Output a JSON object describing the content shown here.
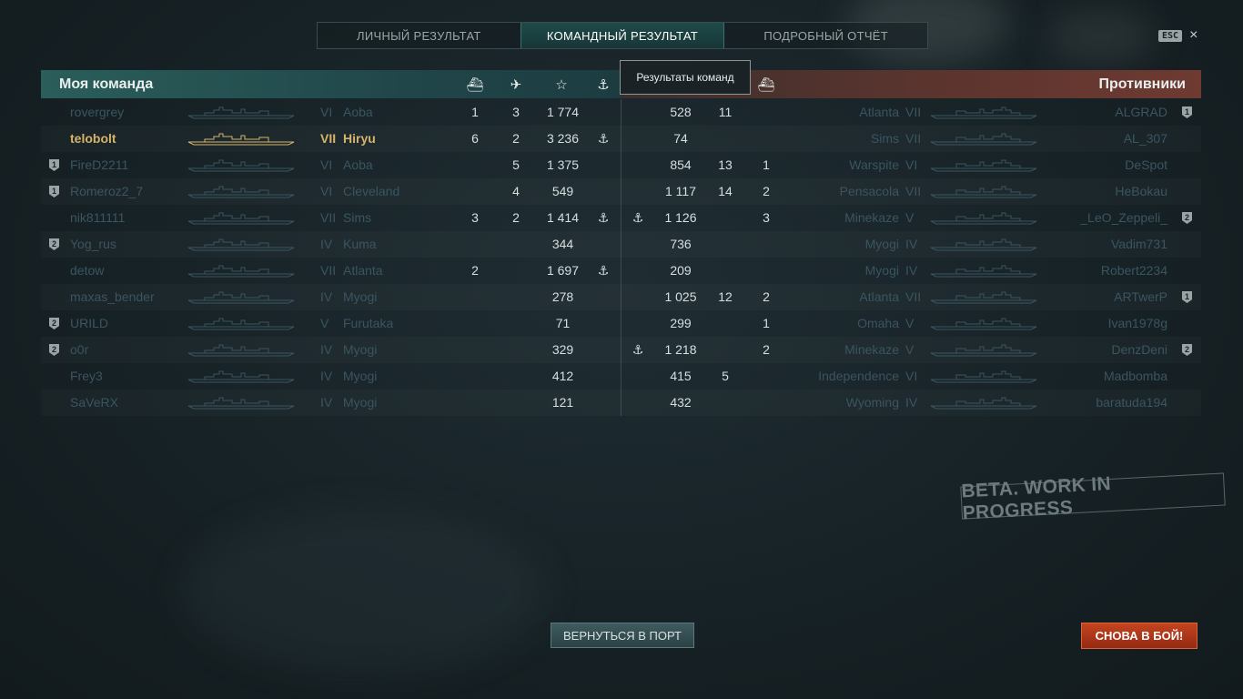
{
  "tabs": [
    {
      "label": "ЛИЧНЫЙ РЕЗУЛЬТАТ",
      "active": false
    },
    {
      "label": "КОМАНДНЫЙ РЕЗУЛЬТАТ",
      "active": true
    },
    {
      "label": "ПОДРОБНЫЙ ОТЧЁТ",
      "active": false
    }
  ],
  "esc_label": "ESC",
  "close_icon": "×",
  "left_team_title": "Моя команда",
  "right_team_title": "Противники",
  "tooltip": "Результаты команд",
  "column_icons": {
    "ships": "⛴",
    "planes": "✈",
    "xp": "☆",
    "anchor": "⚓"
  },
  "left_team": [
    {
      "player": "rovergrey",
      "tier": "VI",
      "ship": "Aoba",
      "kills": "1",
      "planes": "3",
      "xp": "1 774",
      "anchor": "",
      "badge": "",
      "me": false
    },
    {
      "player": "telobolt",
      "tier": "VII",
      "ship": "Hiryu",
      "kills": "6",
      "planes": "2",
      "xp": "3 236",
      "anchor": "⚓",
      "badge": "",
      "me": true
    },
    {
      "player": "FireD2211",
      "tier": "VI",
      "ship": "Aoba",
      "kills": "",
      "planes": "5",
      "xp": "1 375",
      "anchor": "",
      "badge": "1",
      "me": false
    },
    {
      "player": "Romeroz2_7",
      "tier": "VI",
      "ship": "Cleveland",
      "kills": "",
      "planes": "4",
      "xp": "549",
      "anchor": "",
      "badge": "1",
      "me": false
    },
    {
      "player": "nik811111",
      "tier": "VII",
      "ship": "Sims",
      "kills": "3",
      "planes": "2",
      "xp": "1 414",
      "anchor": "⚓",
      "badge": "",
      "me": false
    },
    {
      "player": "Yog_rus",
      "tier": "IV",
      "ship": "Kuma",
      "kills": "",
      "planes": "",
      "xp": "344",
      "anchor": "",
      "badge": "2",
      "me": false
    },
    {
      "player": "detow",
      "tier": "VII",
      "ship": "Atlanta",
      "kills": "2",
      "planes": "",
      "xp": "1 697",
      "anchor": "⚓",
      "badge": "",
      "me": false
    },
    {
      "player": "maxas_bender",
      "tier": "IV",
      "ship": "Myogi",
      "kills": "",
      "planes": "",
      "xp": "278",
      "anchor": "",
      "badge": "",
      "me": false
    },
    {
      "player": "URILD",
      "tier": "V",
      "ship": "Furutaka",
      "kills": "",
      "planes": "",
      "xp": "71",
      "anchor": "",
      "badge": "2",
      "me": false
    },
    {
      "player": "o0r",
      "tier": "IV",
      "ship": "Myogi",
      "kills": "",
      "planes": "",
      "xp": "329",
      "anchor": "",
      "badge": "2",
      "me": false
    },
    {
      "player": "Frey3",
      "tier": "IV",
      "ship": "Myogi",
      "kills": "",
      "planes": "",
      "xp": "412",
      "anchor": "",
      "badge": "",
      "me": false
    },
    {
      "player": "SaVeRX",
      "tier": "IV",
      "ship": "Myogi",
      "kills": "",
      "planes": "",
      "xp": "121",
      "anchor": "",
      "badge": "",
      "me": false
    }
  ],
  "right_team": [
    {
      "player": "ALGRAD",
      "tier": "VII",
      "ship": "Atlanta",
      "anchor": "",
      "xp": "528",
      "planes": "11",
      "kills": "",
      "badge": "1"
    },
    {
      "player": "AL_307",
      "tier": "VII",
      "ship": "Sims",
      "anchor": "",
      "xp": "74",
      "planes": "",
      "kills": "",
      "badge": ""
    },
    {
      "player": "DeSpot",
      "tier": "VI",
      "ship": "Warspite",
      "anchor": "",
      "xp": "854",
      "planes": "13",
      "kills": "1",
      "badge": ""
    },
    {
      "player": "HeBokau",
      "tier": "VII",
      "ship": "Pensacola",
      "anchor": "",
      "xp": "1 117",
      "planes": "14",
      "kills": "2",
      "badge": ""
    },
    {
      "player": "_LeO_Zeppeli_",
      "tier": "V",
      "ship": "Minekaze",
      "anchor": "⚓",
      "xp": "1 126",
      "planes": "",
      "kills": "3",
      "badge": "2"
    },
    {
      "player": "Vadim731",
      "tier": "IV",
      "ship": "Myogi",
      "anchor": "",
      "xp": "736",
      "planes": "",
      "kills": "",
      "badge": ""
    },
    {
      "player": "Robert2234",
      "tier": "IV",
      "ship": "Myogi",
      "anchor": "",
      "xp": "209",
      "planes": "",
      "kills": "",
      "badge": ""
    },
    {
      "player": "ARTwerP",
      "tier": "VII",
      "ship": "Atlanta",
      "anchor": "",
      "xp": "1 025",
      "planes": "12",
      "kills": "2",
      "badge": "1"
    },
    {
      "player": "Ivan1978g",
      "tier": "V",
      "ship": "Omaha",
      "anchor": "",
      "xp": "299",
      "planes": "",
      "kills": "1",
      "badge": ""
    },
    {
      "player": "DenzDeni",
      "tier": "V",
      "ship": "Minekaze",
      "anchor": "⚓",
      "xp": "1 218",
      "planes": "",
      "kills": "2",
      "badge": "2"
    },
    {
      "player": "Madbomba",
      "tier": "VI",
      "ship": "Independence",
      "anchor": "",
      "xp": "415",
      "planes": "5",
      "kills": "",
      "badge": ""
    },
    {
      "player": "baratuda194",
      "tier": "IV",
      "ship": "Wyoming",
      "anchor": "",
      "xp": "432",
      "planes": "",
      "kills": "",
      "badge": ""
    }
  ],
  "beta_label": "BETA. WORK IN PROGRESS",
  "return_button": "ВЕРНУТЬСЯ В ПОРТ",
  "battle_button": "СНОВА В БОЙ!"
}
